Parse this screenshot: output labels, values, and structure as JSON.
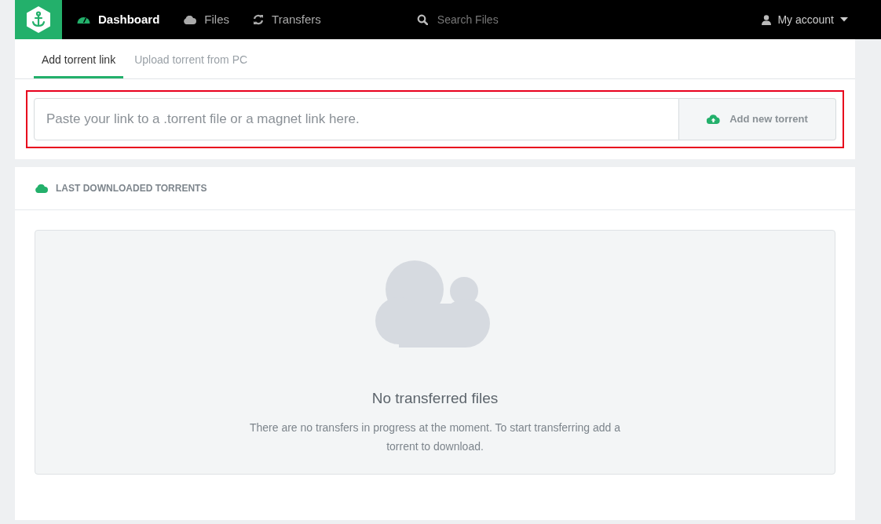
{
  "nav": {
    "items": [
      {
        "label": "Dashboard",
        "selected": true
      },
      {
        "label": "Files",
        "selected": false
      },
      {
        "label": "Transfers",
        "selected": false
      }
    ],
    "search": {
      "placeholder": "Search Files"
    },
    "account": {
      "label": "My account"
    }
  },
  "tabs": [
    {
      "label": "Add torrent link",
      "selected": true
    },
    {
      "label": "Upload torrent from PC",
      "selected": false
    }
  ],
  "link_form": {
    "placeholder": "Paste your link to a .torrent file or a magnet link here.",
    "button": "Add new torrent"
  },
  "last_downloaded": {
    "title": "LAST DOWNLOADED TORRENTS",
    "empty_title": "No transferred files",
    "empty_text": "There are no transfers in progress at the moment. To start transferring add a torrent to download."
  }
}
